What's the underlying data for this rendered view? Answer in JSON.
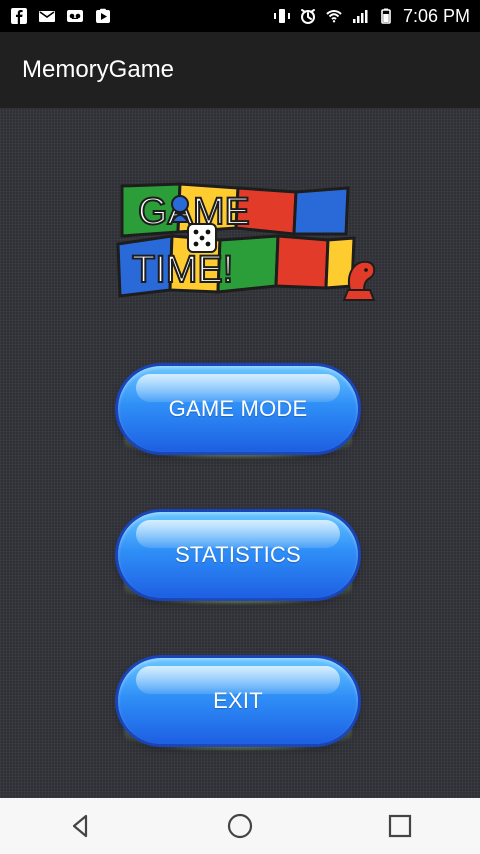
{
  "status_bar": {
    "time": "7:06 PM",
    "left_icons": [
      "facebook-icon",
      "outlook-icon",
      "voicemail-icon",
      "play-store-icon"
    ],
    "right_icons": [
      "vibrate-icon",
      "alarm-icon",
      "wifi-icon",
      "signal-icon",
      "battery-icon"
    ]
  },
  "app_bar": {
    "title": "MemoryGame"
  },
  "logo": {
    "line1": "GAME",
    "line2": "TIME!"
  },
  "buttons": {
    "game_mode": "GAME MODE",
    "statistics": "STATISTICS",
    "exit": "EXIT"
  },
  "nav_bar": {
    "icons": [
      "back-icon",
      "home-icon",
      "recents-icon"
    ]
  },
  "colors": {
    "button_blue": "#2f8ff7",
    "glow_green": "#bff08c",
    "background": "#2f3136"
  }
}
